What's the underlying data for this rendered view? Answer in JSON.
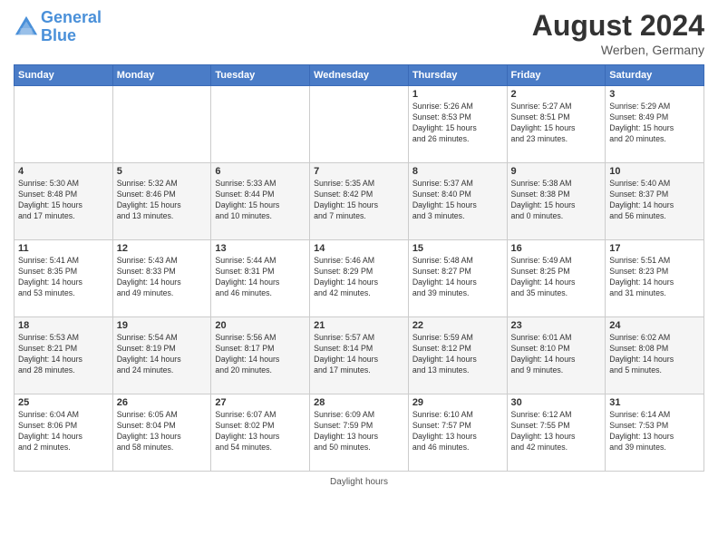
{
  "header": {
    "logo_line1": "General",
    "logo_line2": "Blue",
    "month_year": "August 2024",
    "location": "Werben, Germany"
  },
  "days_of_week": [
    "Sunday",
    "Monday",
    "Tuesday",
    "Wednesday",
    "Thursday",
    "Friday",
    "Saturday"
  ],
  "weeks": [
    [
      {
        "day": "",
        "info": ""
      },
      {
        "day": "",
        "info": ""
      },
      {
        "day": "",
        "info": ""
      },
      {
        "day": "",
        "info": ""
      },
      {
        "day": "1",
        "info": "Sunrise: 5:26 AM\nSunset: 8:53 PM\nDaylight: 15 hours\nand 26 minutes."
      },
      {
        "day": "2",
        "info": "Sunrise: 5:27 AM\nSunset: 8:51 PM\nDaylight: 15 hours\nand 23 minutes."
      },
      {
        "day": "3",
        "info": "Sunrise: 5:29 AM\nSunset: 8:49 PM\nDaylight: 15 hours\nand 20 minutes."
      }
    ],
    [
      {
        "day": "4",
        "info": "Sunrise: 5:30 AM\nSunset: 8:48 PM\nDaylight: 15 hours\nand 17 minutes."
      },
      {
        "day": "5",
        "info": "Sunrise: 5:32 AM\nSunset: 8:46 PM\nDaylight: 15 hours\nand 13 minutes."
      },
      {
        "day": "6",
        "info": "Sunrise: 5:33 AM\nSunset: 8:44 PM\nDaylight: 15 hours\nand 10 minutes."
      },
      {
        "day": "7",
        "info": "Sunrise: 5:35 AM\nSunset: 8:42 PM\nDaylight: 15 hours\nand 7 minutes."
      },
      {
        "day": "8",
        "info": "Sunrise: 5:37 AM\nSunset: 8:40 PM\nDaylight: 15 hours\nand 3 minutes."
      },
      {
        "day": "9",
        "info": "Sunrise: 5:38 AM\nSunset: 8:38 PM\nDaylight: 15 hours\nand 0 minutes."
      },
      {
        "day": "10",
        "info": "Sunrise: 5:40 AM\nSunset: 8:37 PM\nDaylight: 14 hours\nand 56 minutes."
      }
    ],
    [
      {
        "day": "11",
        "info": "Sunrise: 5:41 AM\nSunset: 8:35 PM\nDaylight: 14 hours\nand 53 minutes."
      },
      {
        "day": "12",
        "info": "Sunrise: 5:43 AM\nSunset: 8:33 PM\nDaylight: 14 hours\nand 49 minutes."
      },
      {
        "day": "13",
        "info": "Sunrise: 5:44 AM\nSunset: 8:31 PM\nDaylight: 14 hours\nand 46 minutes."
      },
      {
        "day": "14",
        "info": "Sunrise: 5:46 AM\nSunset: 8:29 PM\nDaylight: 14 hours\nand 42 minutes."
      },
      {
        "day": "15",
        "info": "Sunrise: 5:48 AM\nSunset: 8:27 PM\nDaylight: 14 hours\nand 39 minutes."
      },
      {
        "day": "16",
        "info": "Sunrise: 5:49 AM\nSunset: 8:25 PM\nDaylight: 14 hours\nand 35 minutes."
      },
      {
        "day": "17",
        "info": "Sunrise: 5:51 AM\nSunset: 8:23 PM\nDaylight: 14 hours\nand 31 minutes."
      }
    ],
    [
      {
        "day": "18",
        "info": "Sunrise: 5:53 AM\nSunset: 8:21 PM\nDaylight: 14 hours\nand 28 minutes."
      },
      {
        "day": "19",
        "info": "Sunrise: 5:54 AM\nSunset: 8:19 PM\nDaylight: 14 hours\nand 24 minutes."
      },
      {
        "day": "20",
        "info": "Sunrise: 5:56 AM\nSunset: 8:17 PM\nDaylight: 14 hours\nand 20 minutes."
      },
      {
        "day": "21",
        "info": "Sunrise: 5:57 AM\nSunset: 8:14 PM\nDaylight: 14 hours\nand 17 minutes."
      },
      {
        "day": "22",
        "info": "Sunrise: 5:59 AM\nSunset: 8:12 PM\nDaylight: 14 hours\nand 13 minutes."
      },
      {
        "day": "23",
        "info": "Sunrise: 6:01 AM\nSunset: 8:10 PM\nDaylight: 14 hours\nand 9 minutes."
      },
      {
        "day": "24",
        "info": "Sunrise: 6:02 AM\nSunset: 8:08 PM\nDaylight: 14 hours\nand 5 minutes."
      }
    ],
    [
      {
        "day": "25",
        "info": "Sunrise: 6:04 AM\nSunset: 8:06 PM\nDaylight: 14 hours\nand 2 minutes."
      },
      {
        "day": "26",
        "info": "Sunrise: 6:05 AM\nSunset: 8:04 PM\nDaylight: 13 hours\nand 58 minutes."
      },
      {
        "day": "27",
        "info": "Sunrise: 6:07 AM\nSunset: 8:02 PM\nDaylight: 13 hours\nand 54 minutes."
      },
      {
        "day": "28",
        "info": "Sunrise: 6:09 AM\nSunset: 7:59 PM\nDaylight: 13 hours\nand 50 minutes."
      },
      {
        "day": "29",
        "info": "Sunrise: 6:10 AM\nSunset: 7:57 PM\nDaylight: 13 hours\nand 46 minutes."
      },
      {
        "day": "30",
        "info": "Sunrise: 6:12 AM\nSunset: 7:55 PM\nDaylight: 13 hours\nand 42 minutes."
      },
      {
        "day": "31",
        "info": "Sunrise: 6:14 AM\nSunset: 7:53 PM\nDaylight: 13 hours\nand 39 minutes."
      }
    ]
  ],
  "footer": {
    "daylight_label": "Daylight hours"
  }
}
